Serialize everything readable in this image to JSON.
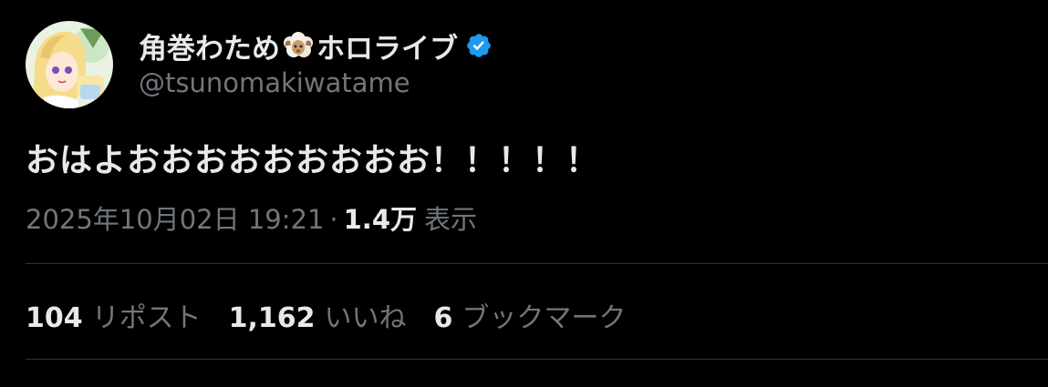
{
  "user": {
    "display_name_prefix": "角巻わため",
    "display_name_suffix": "ホロライブ",
    "handle": "@tsunomakiwatame",
    "verified": true,
    "verified_color": "#1d9bf0"
  },
  "tweet": {
    "text": "おはよおおおおおおおおお！！！！！"
  },
  "meta": {
    "timestamp": "2025年10月02日 19:21",
    "separator": "·",
    "views_count": "1.4万",
    "views_label": "表示"
  },
  "stats": [
    {
      "count": "104",
      "label": "リポスト"
    },
    {
      "count": "1,162",
      "label": "いいね"
    },
    {
      "count": "6",
      "label": "ブックマーク"
    }
  ],
  "colors": {
    "background": "#000000",
    "primary_text": "#e7e9ea",
    "secondary_text": "#71767b",
    "divider": "#2f3336"
  }
}
